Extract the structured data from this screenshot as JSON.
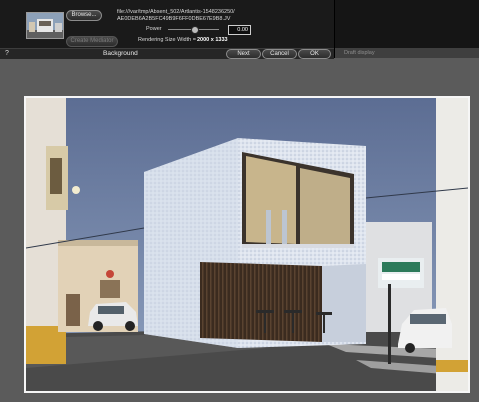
{
  "panel": {
    "browse_label": "Browse...",
    "create_mediator_label": "Create Mediator",
    "path_line1": "file:///var/tmp/Absent_502/Artlantis-1548236250/",
    "path_line2": "AE0DEB6A2B5FC49B9F6FF0DBE67E9B8.JV",
    "power_label": "Power",
    "power_value": "0.00",
    "render_label": "Rendering Size Width = ",
    "render_value": "2000 x 1333",
    "help_label": "?",
    "background_label": "Background",
    "next_label": "Next",
    "cancel_label": "Cancel",
    "ok_label": "OK"
  },
  "right_panel": {
    "draft_label": "Draft display"
  },
  "viewport": {
    "description_icon": "rendered-image"
  }
}
